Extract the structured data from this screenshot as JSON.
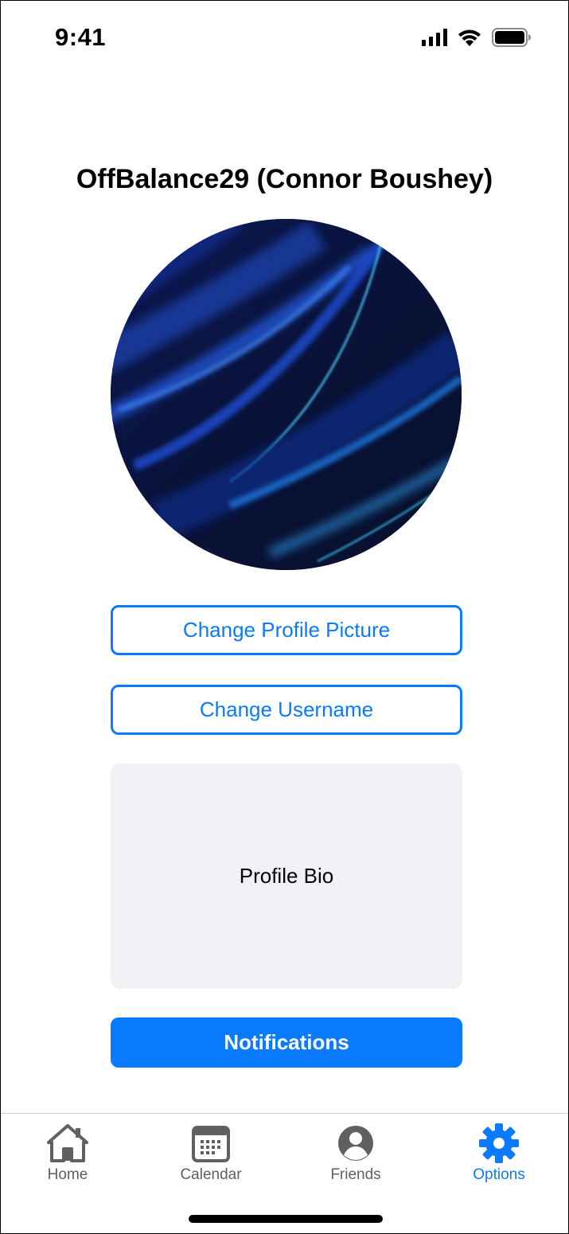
{
  "status_bar": {
    "time": "9:41",
    "icons": [
      "cellular-signal-icon",
      "wifi-icon",
      "battery-icon"
    ]
  },
  "profile": {
    "title": "OffBalance29 (Connor Boushey)",
    "avatar": "abstract-blue-waves-image"
  },
  "buttons": {
    "change_picture": "Change Profile Picture",
    "change_username": "Change Username",
    "notifications": "Notifications"
  },
  "bio": {
    "placeholder": "Profile Bio"
  },
  "tabbar": {
    "active": "options",
    "items": [
      {
        "id": "home",
        "label": "Home",
        "icon": "home-icon"
      },
      {
        "id": "calendar",
        "label": "Calendar",
        "icon": "calendar-icon"
      },
      {
        "id": "friends",
        "label": "Friends",
        "icon": "person-circle-icon"
      },
      {
        "id": "options",
        "label": "Options",
        "icon": "gear-icon"
      }
    ]
  },
  "colors": {
    "accent": "#0a7aff",
    "inactive": "#606060",
    "bio_background": "#f1f1f5"
  }
}
